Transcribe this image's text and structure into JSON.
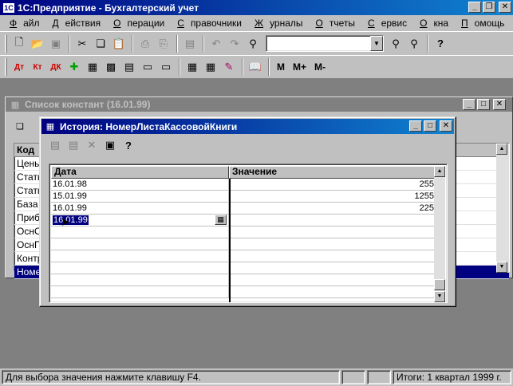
{
  "app": {
    "title": "1С:Предприятие - Бухгалтерский учет",
    "controls": {
      "minimize": "_",
      "restore": "❐",
      "close": "✕"
    }
  },
  "menu": [
    {
      "label": "Файл",
      "key": "Ф",
      "rest": "айл"
    },
    {
      "label": "Действия",
      "key": "Д",
      "rest": "ействия"
    },
    {
      "label": "Операции",
      "key": "О",
      "rest": "перации"
    },
    {
      "label": "Справочники",
      "key": "С",
      "rest": "правочники"
    },
    {
      "label": "Журналы",
      "key": "Ж",
      "rest": "урналы"
    },
    {
      "label": "Отчеты",
      "key": "О",
      "rest": "тчеты"
    },
    {
      "label": "Сервис",
      "key": "С",
      "rest": "ервис"
    },
    {
      "label": "Окна",
      "key": "О",
      "rest": "кна"
    },
    {
      "label": "Помощь",
      "key": "П",
      "rest": "омощь"
    }
  ],
  "toolbar2": {
    "m": "M",
    "m_plus": "M+",
    "m_minus": "M-"
  },
  "constants_window": {
    "title": "Список констант (16.01.99)",
    "header": "Код",
    "rows": [
      "Цены",
      "Стать",
      "Стать",
      "База",
      "Приб",
      "ОснО",
      "ОснП",
      "Контр",
      "Номе"
    ],
    "selected_index": 8
  },
  "history_window": {
    "title": "История: НомерЛистаКассовойКниги",
    "columns": {
      "date": "Дата",
      "value": "Значение"
    },
    "rows": [
      {
        "date": "16.01.98",
        "value": "255"
      },
      {
        "date": "15.01.99",
        "value": "1255"
      },
      {
        "date": "16.01.99",
        "value": "225"
      },
      {
        "date": "16.01.99",
        "value": ""
      }
    ],
    "editing_row": 3
  },
  "status": {
    "hint": "Для выбора значения нажмите клавишу F4.",
    "period": "Итоги: 1 квартал 1999 г."
  }
}
